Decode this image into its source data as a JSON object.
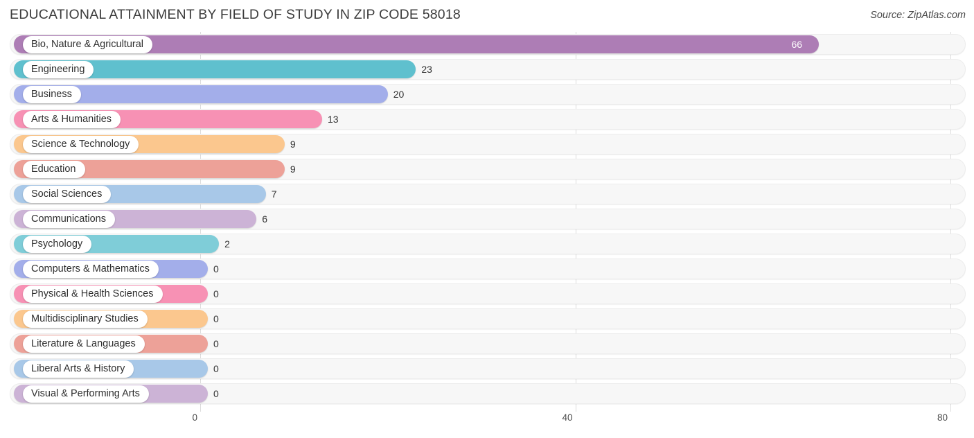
{
  "header": {
    "title": "EDUCATIONAL ATTAINMENT BY FIELD OF STUDY IN ZIP CODE 58018",
    "source": "Source: ZipAtlas.com"
  },
  "chart_data": {
    "type": "bar",
    "orientation": "horizontal",
    "title": "EDUCATIONAL ATTAINMENT BY FIELD OF STUDY IN ZIP CODE 58018",
    "xlabel": "",
    "ylabel": "",
    "xlim": [
      0,
      80
    ],
    "grid": true,
    "legend": "none",
    "ticks": [
      {
        "label": "0",
        "value": 0
      },
      {
        "label": "40",
        "value": 40
      },
      {
        "label": "80",
        "value": 80
      }
    ],
    "categories": [
      "Bio, Nature & Agricultural",
      "Engineering",
      "Business",
      "Arts & Humanities",
      "Science & Technology",
      "Education",
      "Social Sciences",
      "Communications",
      "Psychology",
      "Computers & Mathematics",
      "Physical & Health Sciences",
      "Multidisciplinary Studies",
      "Literature & Languages",
      "Liberal Arts & History",
      "Visual & Performing Arts"
    ],
    "values": [
      66,
      23,
      20,
      13,
      9,
      9,
      7,
      6,
      2,
      0,
      0,
      0,
      0,
      0,
      0
    ],
    "value_labels": [
      "66",
      "23",
      "20",
      "13",
      "9",
      "9",
      "7",
      "6",
      "2",
      "0",
      "0",
      "0",
      "0",
      "0",
      "0"
    ],
    "colors": [
      "#ad7db5",
      "#5fc0ce",
      "#a3aeea",
      "#f791b4",
      "#fbc78e",
      "#eda198",
      "#a8c8e8",
      "#ccb3d6",
      "#7fcdd8",
      "#a3aeea",
      "#f791b4",
      "#fbc78e",
      "#eda198",
      "#a8c8e8",
      "#ccb3d6"
    ]
  }
}
